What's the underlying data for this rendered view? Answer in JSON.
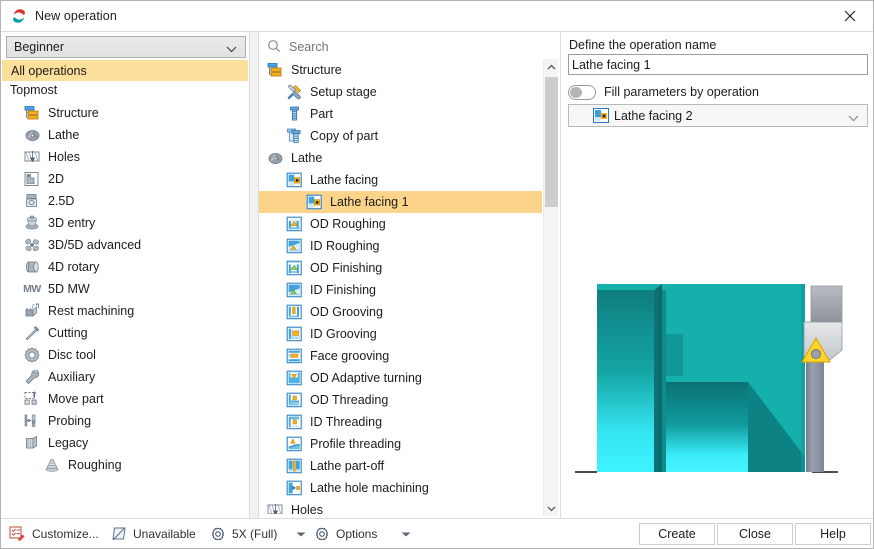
{
  "window": {
    "title": "New operation",
    "app_icon": "swirl-logo-icon",
    "close_icon": "close-icon"
  },
  "left_panel": {
    "level_select": {
      "value": "Beginner",
      "chevron_icon": "chevron-down-icon"
    },
    "all_operations": "All operations",
    "topmost_label": "Topmost",
    "items": [
      {
        "label": "Structure",
        "icon": "structure-icon",
        "sub": false
      },
      {
        "label": "Lathe",
        "icon": "lathe-icon",
        "sub": false
      },
      {
        "label": "Holes",
        "icon": "holes-icon",
        "sub": false
      },
      {
        "label": "2D",
        "icon": "twod-icon",
        "sub": false
      },
      {
        "label": "2.5D",
        "icon": "twofived-icon",
        "sub": false
      },
      {
        "label": "3D entry",
        "icon": "threed-entry-icon",
        "sub": false
      },
      {
        "label": "3D/5D advanced",
        "icon": "threed-fived-icon",
        "sub": false
      },
      {
        "label": "4D rotary",
        "icon": "fourd-rotary-icon",
        "sub": false
      },
      {
        "label": "5D MW",
        "icon": "fived-mw-icon",
        "sub": false
      },
      {
        "label": "Rest machining",
        "icon": "rest-machining-icon",
        "sub": false
      },
      {
        "label": "Cutting",
        "icon": "cutting-icon",
        "sub": false
      },
      {
        "label": "Disc tool",
        "icon": "disc-tool-icon",
        "sub": false
      },
      {
        "label": "Auxiliary",
        "icon": "wrench-icon",
        "sub": false
      },
      {
        "label": "Move part",
        "icon": "move-part-icon",
        "sub": false
      },
      {
        "label": "Probing",
        "icon": "probing-icon",
        "sub": false
      },
      {
        "label": "Legacy",
        "icon": "legacy-icon",
        "sub": false
      },
      {
        "label": "Roughing",
        "icon": "roughing-icon",
        "sub": true
      }
    ]
  },
  "middle_panel": {
    "search": {
      "placeholder": "Search",
      "value": "",
      "icon": "search-icon"
    },
    "tree": [
      {
        "label": "Structure",
        "icon": "structure-icon",
        "depth": 0,
        "selected": false
      },
      {
        "label": "Setup stage",
        "icon": "setup-stage-icon",
        "depth": 1,
        "selected": false
      },
      {
        "label": "Part",
        "icon": "part-icon",
        "depth": 1,
        "selected": false
      },
      {
        "label": "Copy of part",
        "icon": "copy-of-part-icon",
        "depth": 1,
        "selected": false
      },
      {
        "label": "Lathe",
        "icon": "lathe-icon",
        "depth": 0,
        "selected": false
      },
      {
        "label": "Lathe facing",
        "icon": "lathe-facing-icon",
        "depth": 1,
        "selected": false
      },
      {
        "label": "Lathe facing 1",
        "icon": "lathe-facing-icon",
        "depth": 2,
        "selected": true
      },
      {
        "label": "OD Roughing",
        "icon": "od-roughing-icon",
        "depth": 1,
        "selected": false
      },
      {
        "label": "ID Roughing",
        "icon": "id-roughing-icon",
        "depth": 1,
        "selected": false
      },
      {
        "label": "OD Finishing",
        "icon": "od-finishing-icon",
        "depth": 1,
        "selected": false
      },
      {
        "label": "ID Finishing",
        "icon": "id-finishing-icon",
        "depth": 1,
        "selected": false
      },
      {
        "label": "OD Grooving",
        "icon": "od-grooving-icon",
        "depth": 1,
        "selected": false
      },
      {
        "label": "ID Grooving",
        "icon": "id-grooving-icon",
        "depth": 1,
        "selected": false
      },
      {
        "label": "Face grooving",
        "icon": "face-grooving-icon",
        "depth": 1,
        "selected": false
      },
      {
        "label": "OD Adaptive turning",
        "icon": "od-adaptive-icon",
        "depth": 1,
        "selected": false
      },
      {
        "label": "OD Threading",
        "icon": "od-threading-icon",
        "depth": 1,
        "selected": false
      },
      {
        "label": "ID Threading",
        "icon": "id-threading-icon",
        "depth": 1,
        "selected": false
      },
      {
        "label": "Profile threading",
        "icon": "profile-threading-icon",
        "depth": 1,
        "selected": false
      },
      {
        "label": "Lathe part-off",
        "icon": "lathe-partoff-icon",
        "depth": 1,
        "selected": false
      },
      {
        "label": "Lathe hole machining",
        "icon": "lathe-hole-icon",
        "depth": 1,
        "selected": false
      },
      {
        "label": "Holes",
        "icon": "holes-icon",
        "depth": 0,
        "selected": false
      }
    ],
    "scrollbar": {
      "up_icon": "chevron-up-icon",
      "down_icon": "chevron-down-icon"
    }
  },
  "right_panel": {
    "op_name_label": "Define the operation name",
    "op_name_value": "Lathe facing 1",
    "fill_toggle": {
      "label": "Fill parameters by operation",
      "on": false
    },
    "fill_select": {
      "value": "Lathe facing 2",
      "icon": "lathe-facing-icon",
      "chevron_icon": "chevron-down-icon"
    },
    "preview": {
      "name": "lathe-facing-preview",
      "part_color": "#16b0ab",
      "part_highlight": "#45f2ff",
      "part_shadow": "#0c6d70",
      "tool_color": "#8d95a6",
      "insert_color": "#ffd527"
    }
  },
  "bottom_bar": {
    "customize": {
      "label": "Customize...",
      "icon": "customize-icon"
    },
    "unavailable": {
      "label": "Unavailable",
      "icon": "unavailable-icon"
    },
    "axis_mode": {
      "label": "5X (Full)",
      "icon": "gear-icon",
      "chevron_icon": "chevron-down-icon"
    },
    "options": {
      "label": "Options",
      "icon": "gear-icon",
      "chevron_icon": "chevron-down-icon"
    },
    "create_label": "Create",
    "close_label": "Close",
    "help_label": "Help"
  }
}
